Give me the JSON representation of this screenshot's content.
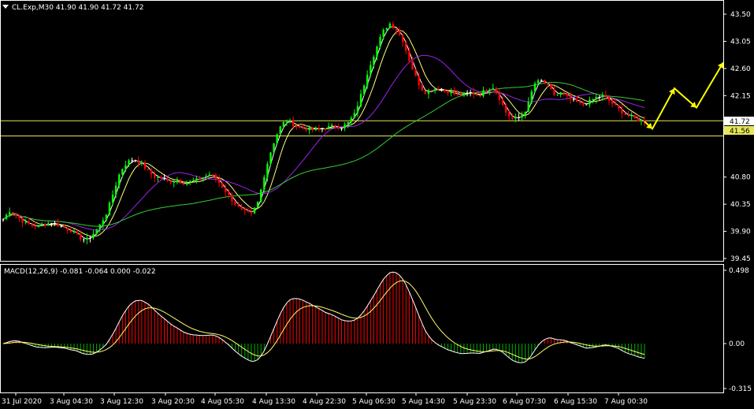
{
  "colors": {
    "background": "#000000",
    "frame": "#ffffff",
    "bull_candle": "#00ff00",
    "bear_candle": "#ff0000",
    "doji": "#ffffff",
    "ma_fast": "#ffffff",
    "ma_mid": "#ffff80",
    "ma_slow": "#a020f0",
    "ma_long": "#32cd32",
    "level_line": "#e6e65a",
    "projection": "#ffff00",
    "macd_pos": "#ff0000",
    "macd_neg": "#00b000",
    "macd_line": "#ffffff",
    "signal_line": "#ffff66",
    "price_tag_bg": "#ffffff",
    "price_tag_ask": "#e6e65a"
  },
  "header": {
    "dropdown_icon": "triangle-down-icon",
    "symbol_text": "CL.Exp,M30  41.90 41.90 41.72 41.72"
  },
  "macd_header": {
    "text": "MACD(12,26,9) -0.081 -0.064 0.000 -0.022"
  },
  "price_tags": {
    "bid": "41.72",
    "ask": "41.56"
  },
  "chart_data": [
    {
      "type": "candlestick",
      "title": "",
      "symbol": "CL.Exp",
      "timeframe": "M30",
      "ohlc_last": {
        "open": 41.9,
        "high": 41.9,
        "low": 41.72,
        "close": 41.72
      },
      "ylim": [
        39.45,
        43.6
      ],
      "y_ticks": [
        "43.50",
        "43.05",
        "42.60",
        "42.15",
        "41.72",
        "41.56",
        "40.80",
        "40.35",
        "39.90",
        "39.45"
      ],
      "x_ticks": [
        "31 Jul 2020",
        "3 Aug 04:30",
        "3 Aug 12:30",
        "3 Aug 20:30",
        "4 Aug 05:30",
        "4 Aug 13:30",
        "4 Aug 22:30",
        "5 Aug 06:30",
        "5 Aug 14:30",
        "5 Aug 23:30",
        "6 Aug 07:30",
        "6 Aug 15:30",
        "7 Aug 00:30"
      ],
      "horizontal_levels": [
        41.72,
        41.56
      ],
      "close_path": [
        40.1,
        40.25,
        40.15,
        40.05,
        40.0,
        39.98,
        40.02,
        40.05,
        40.0,
        39.95,
        39.9,
        39.8,
        39.75,
        39.85,
        40.0,
        40.2,
        40.55,
        40.9,
        41.05,
        41.1,
        41.02,
        40.9,
        40.8,
        40.78,
        40.72,
        40.75,
        40.7,
        40.72,
        40.75,
        40.8,
        40.85,
        40.75,
        40.6,
        40.45,
        40.3,
        40.22,
        40.18,
        40.4,
        40.9,
        41.3,
        41.6,
        41.75,
        41.68,
        41.62,
        41.6,
        41.58,
        41.6,
        41.62,
        41.65,
        41.62,
        41.7,
        41.85,
        42.2,
        42.6,
        42.9,
        43.2,
        43.35,
        43.25,
        43.05,
        42.7,
        42.4,
        42.2,
        42.25,
        42.28,
        42.24,
        42.2,
        42.15,
        42.18,
        42.2,
        42.15,
        42.25,
        42.3,
        42.1,
        41.85,
        41.75,
        41.8,
        41.95,
        42.35,
        42.4,
        42.3,
        42.15,
        42.2,
        42.1,
        42.05,
        42.0,
        42.05,
        42.12,
        42.15,
        42.05,
        41.95,
        41.85,
        41.8,
        41.75,
        41.72
      ],
      "projection": [
        41.72,
        41.6,
        42.27,
        41.95,
        42.7
      ],
      "moving_averages": [
        "ma_fast",
        "ma_mid",
        "ma_slow",
        "ma_long"
      ]
    },
    {
      "type": "macd",
      "title": "",
      "params": "12,26,9",
      "values_shown": [
        -0.081,
        -0.064,
        0.0,
        -0.022
      ],
      "ylim": [
        -0.315,
        0.498
      ],
      "y_ticks": [
        "0.498",
        "0.00",
        "-0.315"
      ]
    }
  ]
}
